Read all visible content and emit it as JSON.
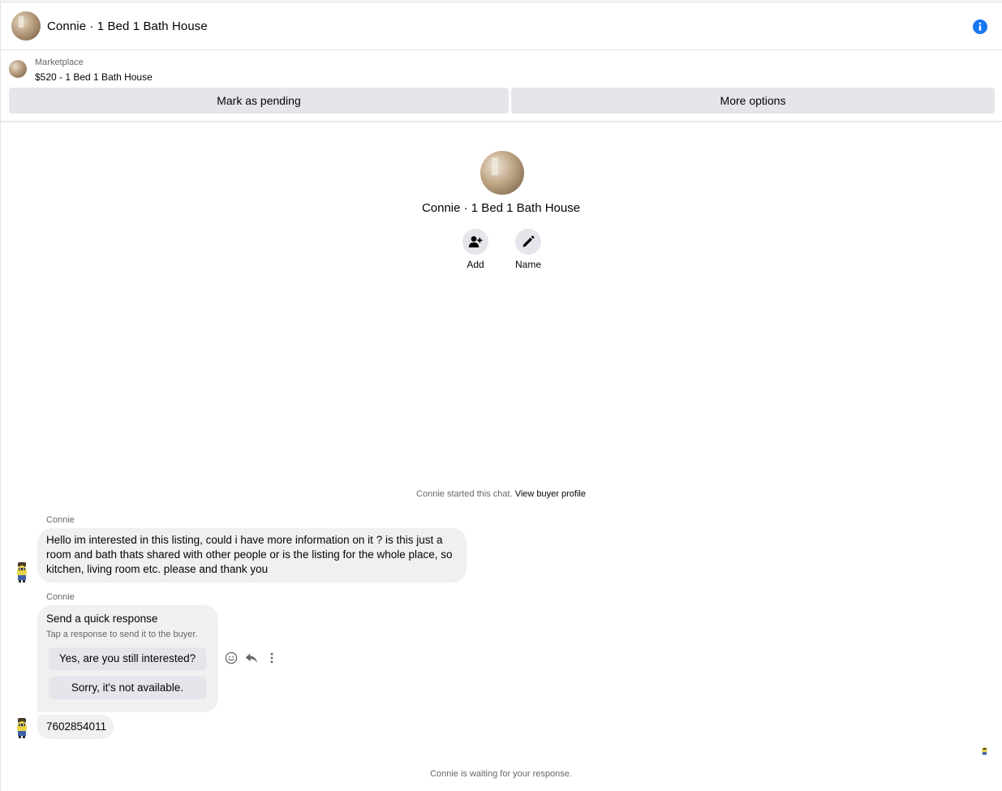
{
  "header": {
    "title": "Connie · 1 Bed 1 Bath House",
    "info_icon": "info-icon",
    "accent_color": "#1877f2"
  },
  "marketplace": {
    "label": "Marketplace",
    "listing": "$520 - 1 Bed 1 Bath House",
    "mark_pending_label": "Mark as pending",
    "more_options_label": "More options"
  },
  "intro": {
    "name": "Connie · 1 Bed 1 Bath House",
    "add_label": "Add",
    "name_label": "Name",
    "add_icon": "add-person-icon",
    "name_icon": "pencil-icon"
  },
  "chat": {
    "started_prefix": "Connie started this chat.",
    "view_profile_link": "View buyer profile",
    "messages": [
      {
        "sender": "Connie",
        "text": "Hello im interested in this listing, could i have more information on it ? is this just a room and bath thats shared with other people or is the listing for the whole place, so kitchen, living room etc. please and thank you"
      },
      {
        "sender": "Connie",
        "quick_response": {
          "title": "Send a quick response",
          "subtitle": "Tap a response to send it to the buyer.",
          "options": [
            "Yes, are you still interested?",
            "Sorry, it's not available."
          ]
        }
      },
      {
        "text": "7602854011"
      }
    ],
    "hover_tools": [
      "emoji-icon",
      "reply-icon",
      "more-vertical-icon"
    ],
    "waiting_text": "Connie is waiting for your response."
  }
}
